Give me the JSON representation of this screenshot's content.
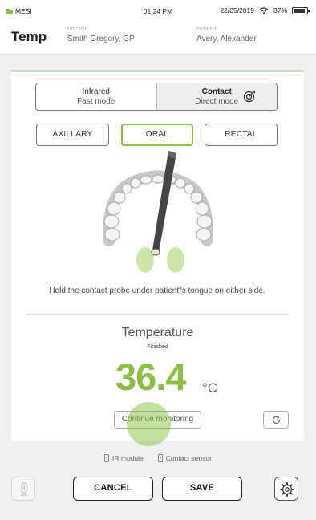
{
  "status_bar": {
    "app_name": "MESI",
    "time": "01:24 PM",
    "date": "22/05/2019",
    "battery": "87%",
    "battery_level": 0.87
  },
  "header": {
    "title": "Temp",
    "doctor_caption": "DOCTOR",
    "doctor_name": "Smith Gregory, GP",
    "patient_caption": "PATIENT",
    "patient_name": "Avery, Alexander"
  },
  "mode_toggle": {
    "options": [
      {
        "title": "Infrared",
        "subtitle": "Fast mode",
        "selected": false
      },
      {
        "title": "Contact",
        "subtitle": "Direct mode",
        "selected": true
      }
    ]
  },
  "measurement_sites": {
    "options": [
      "AXILLARY",
      "ORAL",
      "RECTAL"
    ],
    "selected": "ORAL"
  },
  "instruction": "Hold the contact probe under patient\"s tongue on either side.",
  "result": {
    "label": "Temperature",
    "status": "Finished",
    "value": "36.4",
    "unit": "°C"
  },
  "continue_button": "Continue monitoring",
  "sensors": [
    "IR module",
    "Contact sensor"
  ],
  "footer": {
    "cancel_label": "CANCEL",
    "save_label": "SAVE"
  },
  "colors": {
    "accent": "#8cc044",
    "card_bar": "#c8dcc0",
    "background": "#f0f0ee"
  },
  "icons": [
    "leaf-icon",
    "wifi-icon",
    "battery-icon",
    "target-icon",
    "probe-icon",
    "refresh-icon",
    "plug-icon",
    "alert-icon",
    "gear-icon"
  ]
}
